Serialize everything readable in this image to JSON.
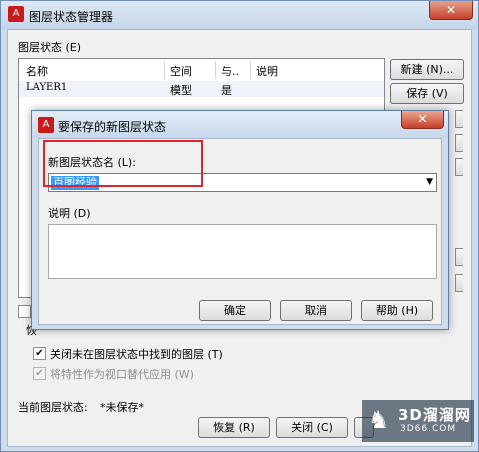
{
  "window": {
    "title": "图层状态管理器",
    "close_glyph": "✕",
    "app_icon_glyph": "A",
    "layer_states_label": "图层状态 (E)",
    "columns": [
      "名称",
      "空间",
      "与..",
      "说明"
    ],
    "rows": [
      {
        "name": "LAYER1",
        "space": "模型",
        "same": "是",
        "desc": ""
      }
    ],
    "buttons": {
      "new": "新建 (N)...",
      "save": "保存 (V)"
    },
    "options": {
      "close_not_found": {
        "label": "关闭未在图层状态中找到的图层 (T)",
        "checked": true,
        "enabled": true
      },
      "apply_viewport": {
        "label": "将特性作为视口替代应用 (W)",
        "checked": true,
        "enabled": false
      }
    },
    "stub_char": "恢",
    "current_state_label": "当前图层状态:",
    "current_state_value": "*未保存*",
    "footer_buttons": {
      "restore": "恢复 (R)",
      "close": "关闭 (C)"
    }
  },
  "dialog": {
    "title": "要保存的新图层状态",
    "close_glyph": "✕",
    "app_icon_glyph": "A",
    "name_label": "新图层状态名 (L):",
    "name_value": "百图经验",
    "desc_label": "说明 (D)",
    "desc_value": "",
    "buttons": {
      "ok": "确定",
      "cancel": "取消",
      "help": "帮助 (H)"
    }
  },
  "watermark": {
    "brand": "3D溜溜网",
    "url": "3D66.COM"
  },
  "icons": {
    "app": "autocad-logo-icon",
    "close": "close-icon",
    "dropdown": "chevron-down-icon",
    "check": "checkmark-icon",
    "deer": "deer-logo-icon"
  },
  "colors": {
    "highlight_box": "#e0242b",
    "selection": "#3399ff",
    "close_button": "#c53e28",
    "app_icon": "#c81a1a"
  }
}
